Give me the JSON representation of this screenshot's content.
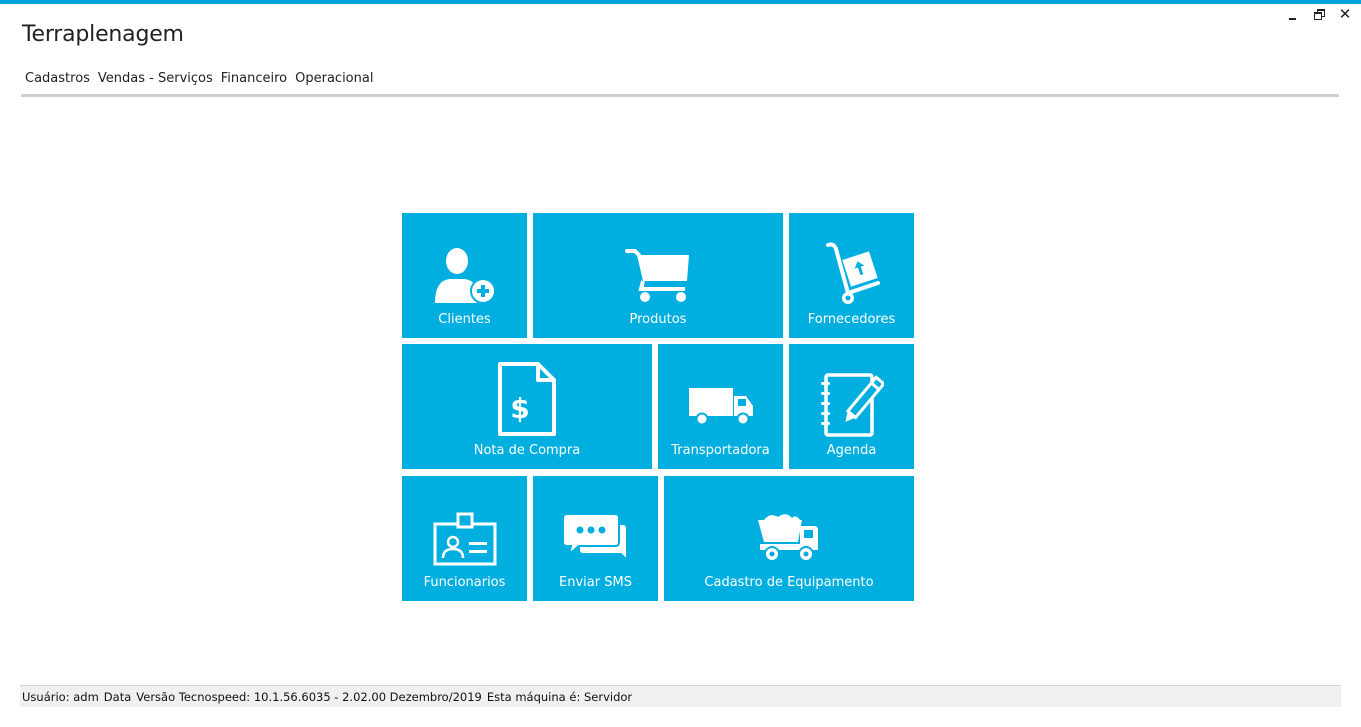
{
  "app": {
    "title": "Terraplenagem"
  },
  "window": {
    "minimize_icon": "minimize-icon",
    "restore_icon": "restore-icon",
    "close_glyph": "✕"
  },
  "tabs": [
    {
      "label": "Cadastros",
      "active": true
    },
    {
      "label": "Vendas - Serviços",
      "active": false
    },
    {
      "label": "Financeiro",
      "active": false
    },
    {
      "label": "Operacional",
      "active": false
    }
  ],
  "tiles": [
    {
      "label": "Clientes",
      "icon": "add-person-icon"
    },
    {
      "label": "Produtos",
      "icon": "shopping-cart-icon"
    },
    {
      "label": "Fornecedores",
      "icon": "hand-truck-icon"
    },
    {
      "label": "Nota de Compra",
      "icon": "dollar-document-icon"
    },
    {
      "label": "Transportadora",
      "icon": "truck-icon"
    },
    {
      "label": "Agenda",
      "icon": "notebook-pencil-icon"
    },
    {
      "label": "Funcionarios",
      "icon": "id-badge-icon"
    },
    {
      "label": "Enviar SMS",
      "icon": "chat-bubbles-icon"
    },
    {
      "label": "Cadastro de Equipamento",
      "icon": "dump-truck-icon"
    }
  ],
  "status": {
    "user": "Usuário: adm",
    "date": "Data",
    "version": "Versão Tecnospeed:  10.1.56.6035 - 2.02.00 Dezembro/2019",
    "machine": "Esta máquina é: Servidor"
  },
  "colors": {
    "accent": "#00a2d8",
    "tile": "#00afdf",
    "tab_rule": "#cfcfcf"
  }
}
